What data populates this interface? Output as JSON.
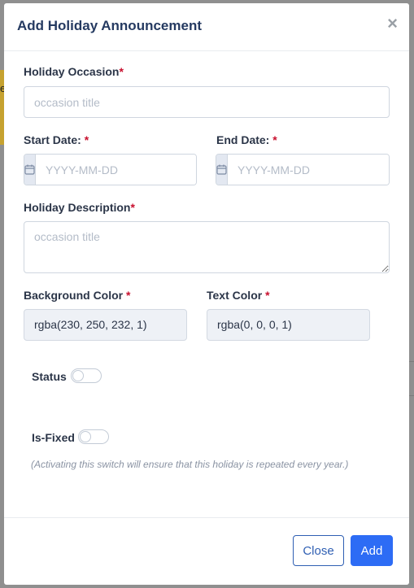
{
  "modal": {
    "title": "Add Holiday Announcement",
    "close_symbol": "×"
  },
  "form": {
    "occasion": {
      "label": "Holiday Occasion",
      "required_mark": "*",
      "placeholder": "occasion title",
      "value": ""
    },
    "start_date": {
      "label": "Start Date: ",
      "required_mark": "*",
      "placeholder": "YYYY-MM-DD",
      "icon": "calendar-icon"
    },
    "end_date": {
      "label": "End Date: ",
      "required_mark": "*",
      "placeholder": "YYYY-MM-DD",
      "icon": "calendar-icon"
    },
    "description": {
      "label": "Holiday Description",
      "required_mark": "*",
      "placeholder": "occasion title",
      "value": ""
    },
    "background_color": {
      "label": "Background Color ",
      "required_mark": "*",
      "value": "rgba(230, 250, 232, 1)"
    },
    "text_color": {
      "label": "Text Color ",
      "required_mark": "*",
      "value": "rgba(0, 0, 0, 1)"
    },
    "status": {
      "label": "Status",
      "on": false
    },
    "is_fixed": {
      "label": "Is-Fixed",
      "on": false,
      "hint": "(Activating this switch will ensure that this holiday is repeated every year.)"
    }
  },
  "footer": {
    "close_label": "Close",
    "add_label": "Add"
  },
  "colors": {
    "primary": "#2d6cf5",
    "title": "#253a61",
    "required": "#c8102e"
  }
}
